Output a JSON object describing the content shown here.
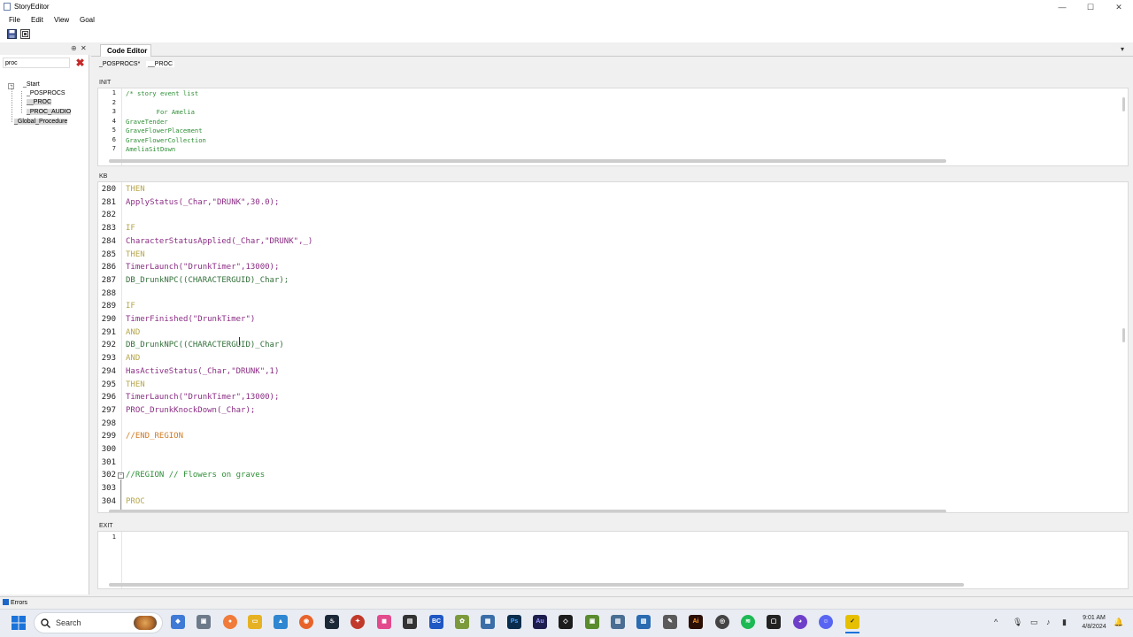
{
  "window": {
    "title": "StoryEditor",
    "min": "—",
    "max": "☐",
    "close": "✕"
  },
  "menu": [
    "File",
    "Edit",
    "View",
    "Goal"
  ],
  "left_panel": {
    "pin": "⊕",
    "close": "✕",
    "search_value": "proc",
    "tree": [
      {
        "label": "_Start",
        "selected": false
      },
      {
        "label": "_POSPROCS",
        "selected": false
      },
      {
        "label": "__PROC",
        "selected": true
      },
      {
        "label": "_PROC_AUDIO",
        "selected": true
      },
      {
        "label": "_Global_Procedure",
        "selected": true
      }
    ]
  },
  "editor": {
    "tab_label": "Code Editor",
    "dropdown": "▾",
    "subtabs": [
      "_POSPROCS*",
      "__PROC"
    ],
    "init_label": "INIT",
    "kb_label": "KB",
    "exit_label": "EXIT",
    "init_lines": [
      {
        "n": "1",
        "text": "/* story event list"
      },
      {
        "n": "2",
        "text": ""
      },
      {
        "n": "3",
        "text": "        For Amelia"
      },
      {
        "n": "4",
        "text": "GraveTender"
      },
      {
        "n": "5",
        "text": "GraveFlowerPlacement"
      },
      {
        "n": "6",
        "text": "GraveFlowerCollection"
      },
      {
        "n": "7",
        "text": "AmeliaSitDown"
      }
    ],
    "kb_lines": [
      {
        "n": "280",
        "text": "THEN"
      },
      {
        "n": "281",
        "text": "ApplyStatus(_Char,\"DRUNK\",30.0);"
      },
      {
        "n": "282",
        "text": ""
      },
      {
        "n": "283",
        "text": "IF"
      },
      {
        "n": "284",
        "text": "CharacterStatusApplied(_Char,\"DRUNK\",_)"
      },
      {
        "n": "285",
        "text": "THEN"
      },
      {
        "n": "286",
        "text": "TimerLaunch(\"DrunkTimer\",13000);"
      },
      {
        "n": "287",
        "text": "DB_DrunkNPC((CHARACTERGUID)_Char);"
      },
      {
        "n": "288",
        "text": ""
      },
      {
        "n": "289",
        "text": "IF"
      },
      {
        "n": "290",
        "text": "TimerFinished(\"DrunkTimer\")"
      },
      {
        "n": "291",
        "text": "AND"
      },
      {
        "n": "292",
        "text": "DB_DrunkNPC((CHARACTERGUID)_Char)"
      },
      {
        "n": "293",
        "text": "AND"
      },
      {
        "n": "294",
        "text": "HasActiveStatus(_Char,\"DRUNK\",1)"
      },
      {
        "n": "295",
        "text": "THEN"
      },
      {
        "n": "296",
        "text": "TimerLaunch(\"DrunkTimer\",13000);"
      },
      {
        "n": "297",
        "text": "PROC_DrunkKnockDown(_Char);"
      },
      {
        "n": "298",
        "text": ""
      },
      {
        "n": "299",
        "text": "//END_REGION"
      },
      {
        "n": "300",
        "text": ""
      },
      {
        "n": "301",
        "text": ""
      },
      {
        "n": "302",
        "text": "//REGION // Flowers on graves"
      },
      {
        "n": "303",
        "text": ""
      },
      {
        "n": "304",
        "text": "PROC"
      }
    ],
    "exit_lines": [
      {
        "n": "1",
        "text": ""
      }
    ]
  },
  "bottom": {
    "errors_tab": "Errors"
  },
  "taskbar": {
    "search_label": "Search",
    "apps": [
      "files",
      "firefox",
      "steam",
      "ps",
      "au",
      "bc",
      "ai"
    ],
    "clock_time": "9:01 AM",
    "clock_date": "4/8/2024"
  },
  "colors": {
    "keyword": "#b6a74a",
    "function": "#8b2d84",
    "string": "#a31515",
    "type": "#2b4fb0",
    "comment": "#2f8f37"
  }
}
